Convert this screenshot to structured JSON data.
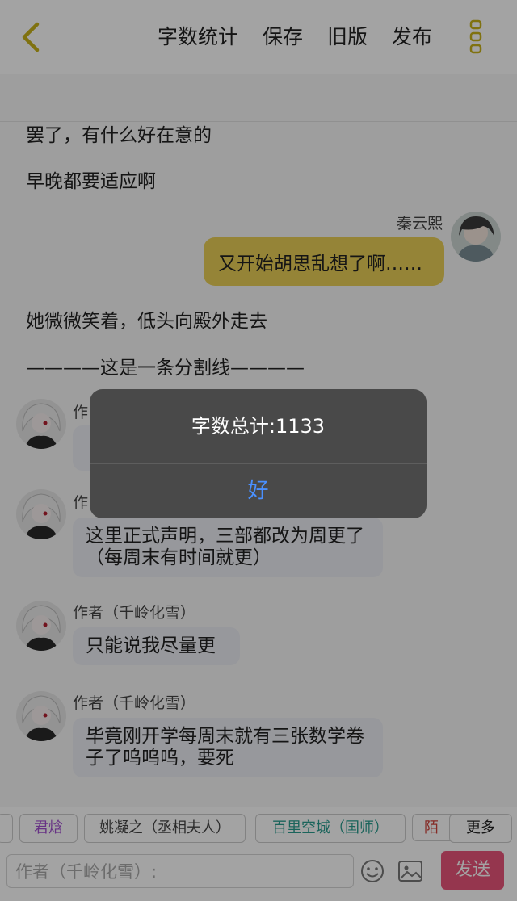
{
  "nav": {
    "actions": [
      "字数统计",
      "保存",
      "旧版",
      "发布"
    ]
  },
  "content": {
    "narration": [
      "罢了，有什么好在意的",
      "早晚都要适应啊"
    ],
    "right_message": {
      "name": "秦云熙",
      "text": "又开始胡思乱想了啊……"
    },
    "narration2": "她微微笑着，低头向殿外走去",
    "separator": "————这是一条分割线————",
    "author_messages": [
      {
        "name": "作",
        "text": ""
      },
      {
        "name": "作",
        "text": "这里正式声明，三部都改为周更了（每周末有时间就更）"
      },
      {
        "name": "作者（千岭化雪）",
        "text": "只能说我尽量更"
      },
      {
        "name": "作者（千岭化雪）",
        "text": "毕竟刚开学每周末就有三张数学卷子了呜呜呜，要死"
      }
    ]
  },
  "tags": [
    "君焓",
    "姚凝之（丞相夫人）",
    "百里空城（国师）",
    "陌"
  ],
  "tag_colors": {
    "purple": "#a24fd0",
    "gray": "#444444",
    "teal": "#2a9d8f",
    "red": "#d0433a"
  },
  "more_label": "更多",
  "input": {
    "placeholder": "作者（千岭化雪）:"
  },
  "send_label": "发送",
  "alert": {
    "message": "字数总计:1133",
    "ok_label": "好"
  },
  "colors": {
    "accent_yellow": "#e9cf57",
    "send_pink": "#e9557a",
    "link_blue": "#4a90ff"
  }
}
